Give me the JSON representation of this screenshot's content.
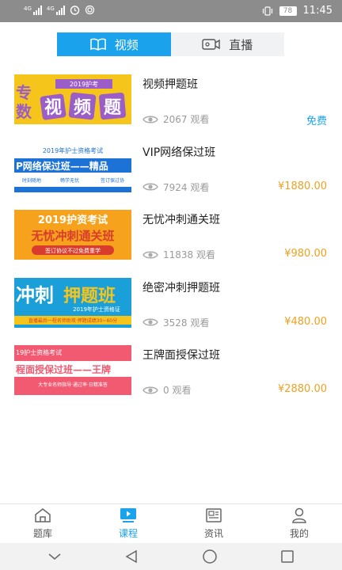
{
  "status_bar": {
    "signal1": "4G",
    "signal2": "4G",
    "battery": "78",
    "time": "11:45",
    "icons": [
      "signal-icon",
      "signal-icon",
      "alarm-icon",
      "fingerprint-icon",
      "vibrate-icon",
      "battery-icon"
    ]
  },
  "tabs": [
    {
      "label": "视频",
      "icon": "book-icon",
      "active": true
    },
    {
      "label": "直播",
      "icon": "video-camera-icon",
      "active": false
    }
  ],
  "courses": [
    {
      "title": "视频押题班",
      "views": "2067 观看",
      "price": "免费",
      "free": true,
      "thumb_text": [
        "2019护考",
        "专",
        "数",
        "视",
        "频",
        "题"
      ],
      "thumb_colors": [
        "#f6c51b",
        "#9b5dc8"
      ]
    },
    {
      "title": "VIP网络保过班",
      "views": "7924 观看",
      "price": "¥1880.00",
      "free": false,
      "thumb_text": [
        "2019年护士资格考试",
        "P网络保过班——精品",
        "时刻随地",
        "畅学无忧",
        "签订保过协"
      ],
      "thumb_colors": [
        "#ffffff",
        "#1d72d6"
      ]
    },
    {
      "title": "无忧冲刺通关班",
      "views": "11838 观看",
      "price": "¥980.00",
      "free": false,
      "thumb_text": [
        "2019护资考试",
        "无忧冲刺通关班",
        "签订协议不过免费重学"
      ],
      "thumb_colors": [
        "#f6a21c",
        "#d93c2c"
      ]
    },
    {
      "title": "绝密冲刺押题班",
      "views": "3528 观看",
      "price": "¥480.00",
      "free": false,
      "thumb_text": [
        "冲刺",
        "押题班",
        "2019年护士资格证",
        "直播最后一程名师助攻·押题成绩30~60分"
      ],
      "thumb_colors": [
        "#1a9fd9",
        "#f6c51b"
      ]
    },
    {
      "title": "王牌面授保过班",
      "views": "0 观看",
      "price": "¥2880.00",
      "free": false,
      "thumb_text": [
        "19护士资格考试",
        "程面授保过班——王牌",
        "大专业名师指导·通过率·日精准答"
      ],
      "thumb_colors": [
        "#f25a72",
        "#ffffff"
      ]
    }
  ],
  "bottom_nav": [
    {
      "label": "题库",
      "icon": "home-icon",
      "active": false
    },
    {
      "label": "课程",
      "icon": "play-course-icon",
      "active": true
    },
    {
      "label": "资讯",
      "icon": "news-icon",
      "active": false
    },
    {
      "label": "我的",
      "icon": "user-icon",
      "active": false
    }
  ],
  "system_nav": {
    "icons": [
      "chevron-down-icon",
      "back-icon",
      "home-circle-icon",
      "recent-apps-icon"
    ]
  },
  "colors": {
    "accent": "#1aa3ec",
    "price": "#f0a020",
    "status_bar": "#8c8c8c"
  }
}
